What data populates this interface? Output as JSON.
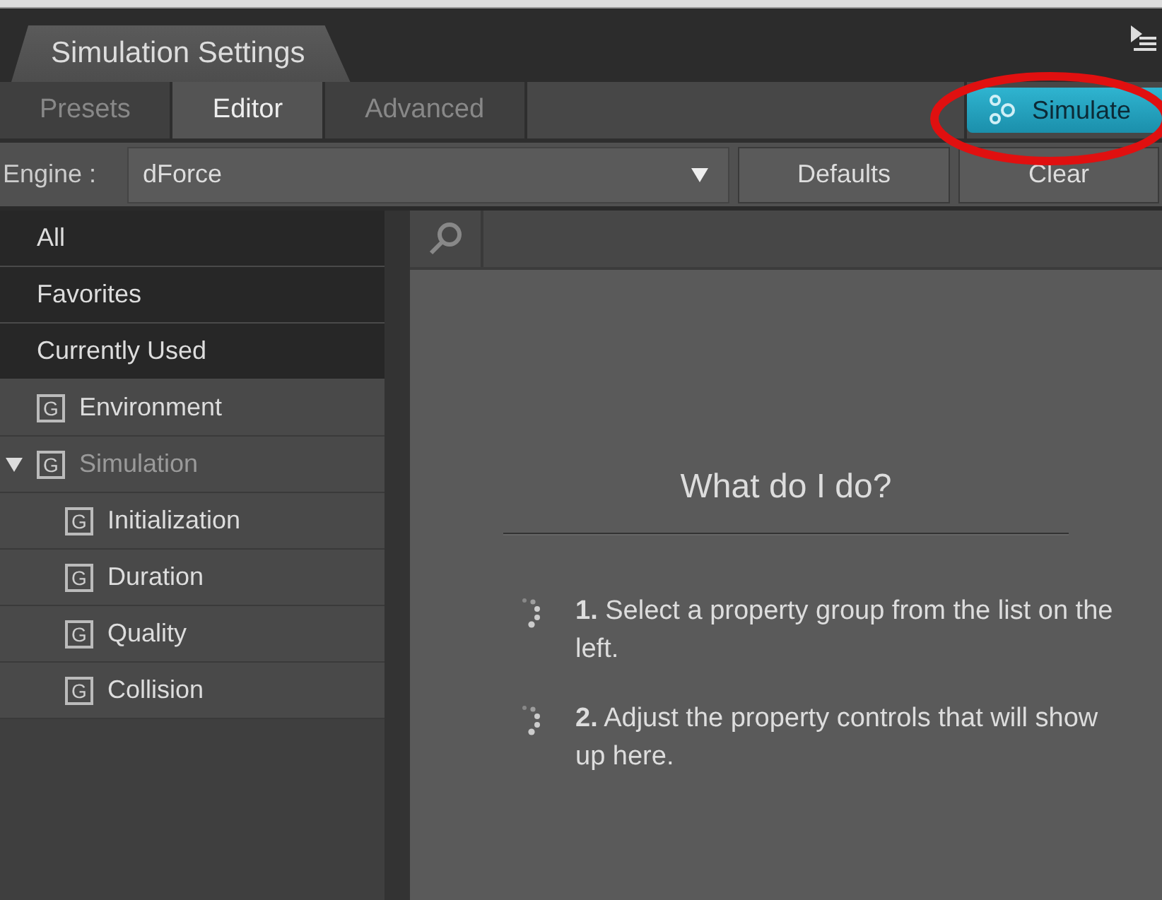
{
  "panel": {
    "title": "Simulation Settings"
  },
  "tabs": [
    {
      "label": "Presets",
      "selected": false
    },
    {
      "label": "Editor",
      "selected": true
    },
    {
      "label": "Advanced",
      "selected": false
    }
  ],
  "simulate_button": {
    "label": "Simulate",
    "highlighted": true
  },
  "engine": {
    "label": "Engine :",
    "value": "dForce"
  },
  "buttons": [
    "Defaults",
    "Clear"
  ],
  "categories": [
    {
      "label": "All"
    },
    {
      "label": "Favorites"
    },
    {
      "label": "Currently Used"
    }
  ],
  "groups": [
    {
      "badge": "G",
      "label": "Environment",
      "disabled": false
    },
    {
      "badge": "G",
      "label": "Simulation",
      "disabled": true,
      "expanded": true,
      "children": [
        {
          "badge": "G",
          "label": "Initialization",
          "disabled": false
        },
        {
          "badge": "G",
          "label": "Duration",
          "disabled": false
        },
        {
          "badge": "G",
          "label": "Quality",
          "disabled": false
        },
        {
          "badge": "G",
          "label": "Collision",
          "disabled": false
        }
      ]
    }
  ],
  "help": {
    "heading": "What do I do?",
    "steps": [
      "**1.** Select a property group from the list on the left.",
      "**2.** Adjust the property controls that will show up here."
    ]
  }
}
